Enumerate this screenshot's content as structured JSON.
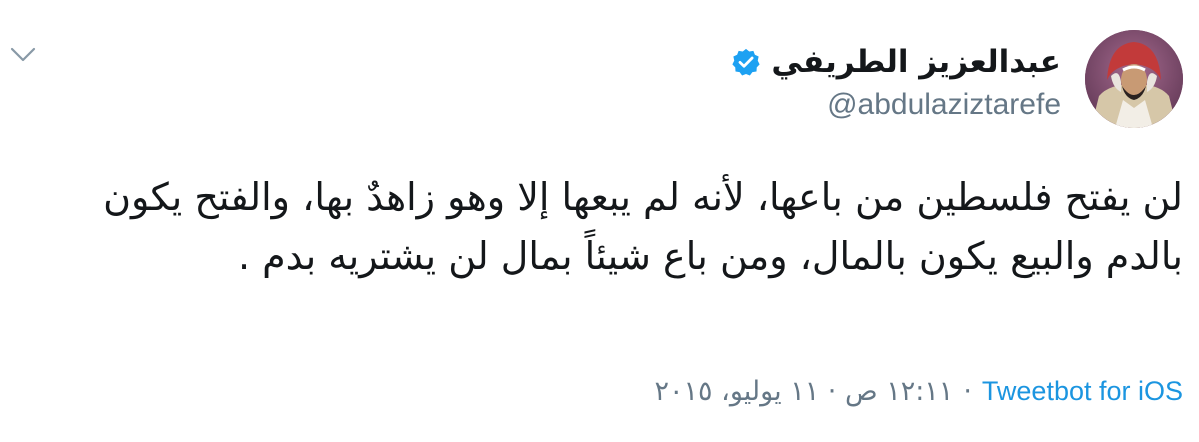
{
  "tweet": {
    "author": {
      "display_name": "عبدالعزيز الطريفي",
      "handle": "@abdulaziztarefe",
      "verified": true
    },
    "text": "لن يفتح فلسطين من باعها، لأنه لم يبعها إلا وهو زاهدٌ بها، والفتح يكون بالدم والبيع يكون بالمال، ومن باع شيئاً بمال لن يشتريه بدم .",
    "timestamp": "١٢:١١ ص · ١١ يوليو، ٢٠١٥",
    "separator": "·",
    "source": "Tweetbot for iOS"
  },
  "colors": {
    "accent": "#1b95e0",
    "secondary_text": "#657786",
    "primary_text": "#14171a",
    "verified_badge": "#1da1f2"
  },
  "icons": {
    "menu": "chevron-down-icon",
    "verified": "verified-badge-icon"
  }
}
